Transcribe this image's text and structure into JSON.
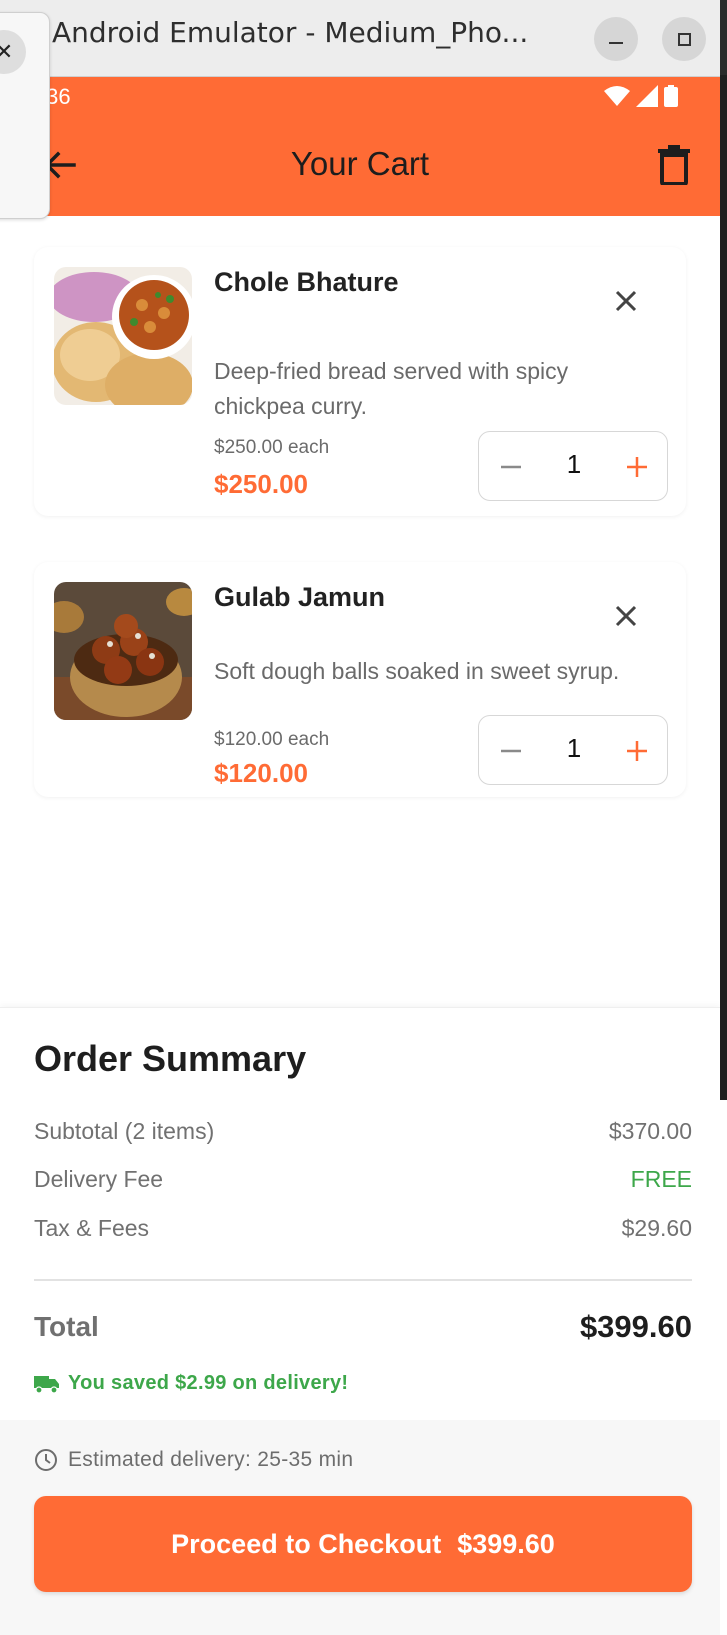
{
  "window": {
    "title": "Android Emulator - Medium_Pho..."
  },
  "status_bar": {
    "time": ":36"
  },
  "app_bar": {
    "title": "Your Cart"
  },
  "cart_items": [
    {
      "name": "Chole Bhature",
      "description": "Deep-fried bread served with spicy chickpea curry.",
      "unit_price": "$250.00 each",
      "line_total": "$250.00",
      "quantity": "1"
    },
    {
      "name": "Gulab Jamun",
      "description": "Soft dough balls soaked in sweet syrup.",
      "unit_price": "$120.00 each",
      "line_total": "$120.00",
      "quantity": "1"
    }
  ],
  "summary": {
    "title": "Order Summary",
    "subtotal_label": "Subtotal (2 items)",
    "subtotal_value": "$370.00",
    "delivery_label": "Delivery Fee",
    "delivery_value": "FREE",
    "tax_label": "Tax & Fees",
    "tax_value": "$29.60",
    "total_label": "Total",
    "total_value": "$399.60",
    "savings": "You saved $2.99 on delivery!"
  },
  "footer": {
    "eta": "Estimated delivery: 25-35 min",
    "checkout_label": "Proceed to Checkout",
    "checkout_amount": "$399.60"
  },
  "colors": {
    "accent": "#FF6B35",
    "success": "#3DA74A"
  },
  "icons": [
    "close-icon",
    "minimize-icon",
    "maximize-icon",
    "wifi-icon",
    "signal-icon",
    "battery-icon",
    "back-arrow-icon",
    "trash-icon",
    "remove-item-icon",
    "minus-icon",
    "plus-icon",
    "truck-icon",
    "clock-icon"
  ]
}
